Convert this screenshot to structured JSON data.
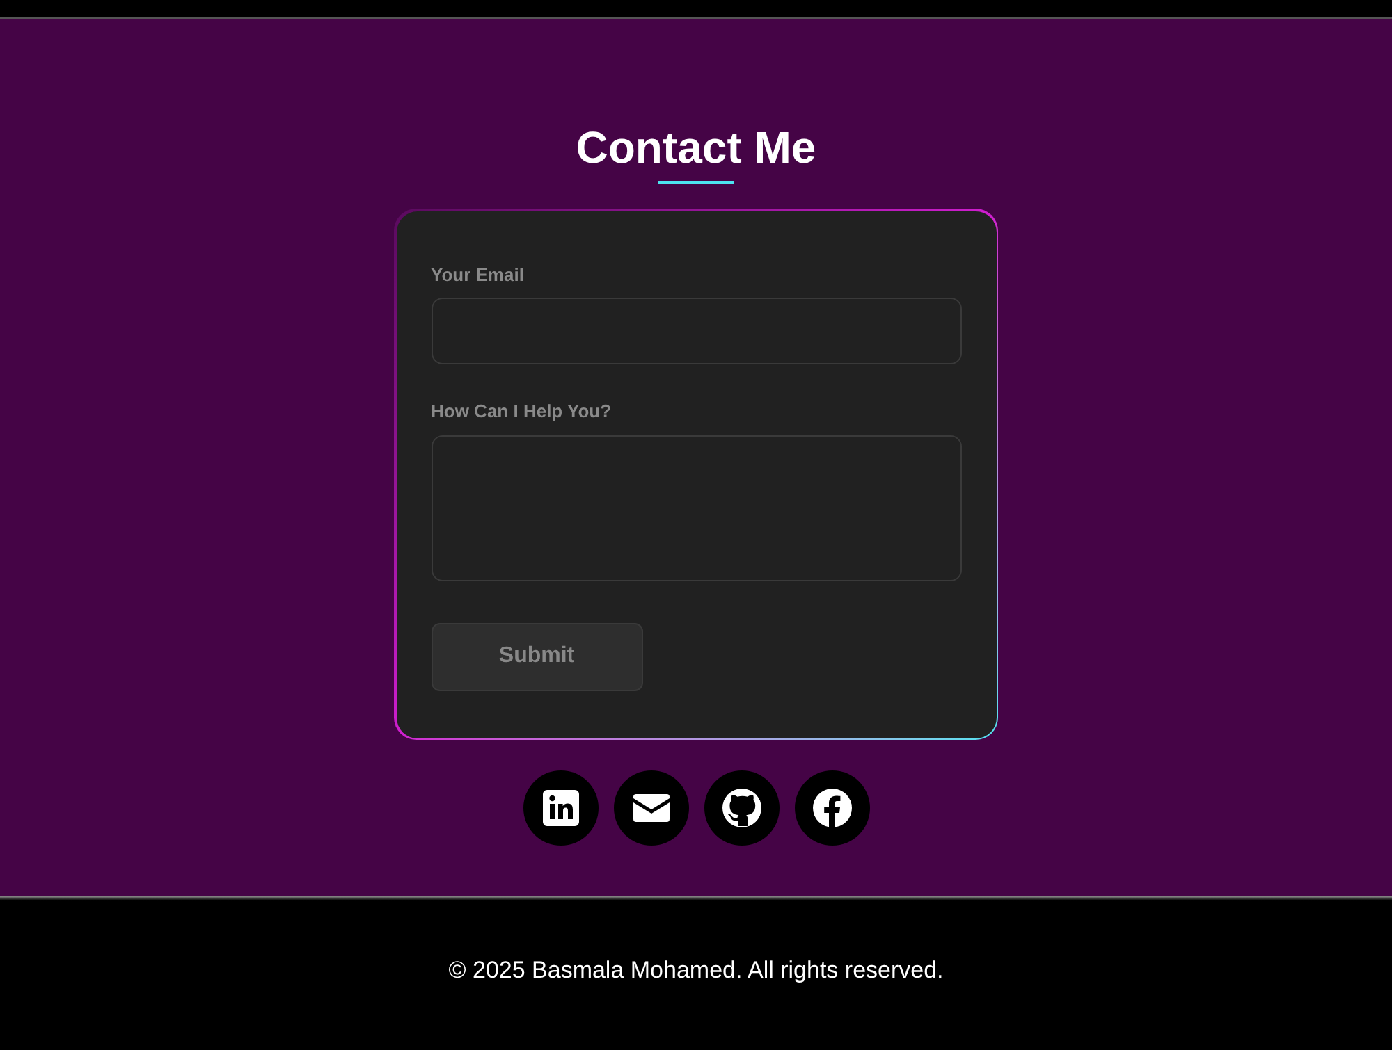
{
  "title": "Contact Me",
  "form": {
    "fields": [
      {
        "kind": "input",
        "label": "Your Email"
      },
      {
        "kind": "textarea",
        "label": "How Can I Help You?"
      }
    ],
    "submit": "Submit"
  },
  "social_links": [
    {
      "kind": "linkedin"
    },
    {
      "kind": "email"
    },
    {
      "kind": "github"
    },
    {
      "kind": "facebook"
    }
  ],
  "footer": "© 2025 Basmala Mohamed. All rights reserved."
}
